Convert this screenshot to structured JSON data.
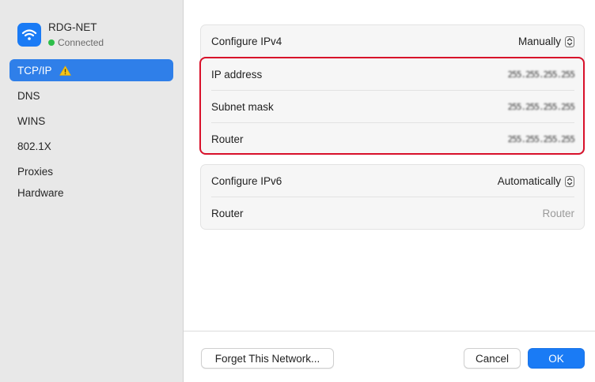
{
  "sidebar": {
    "network": {
      "name": "RDG-NET",
      "status": "Connected"
    },
    "items": [
      {
        "label": "TCP/IP",
        "selected": true,
        "warning": true
      },
      {
        "label": "DNS"
      },
      {
        "label": "WINS"
      },
      {
        "label": "802.1X"
      },
      {
        "label": "Proxies"
      },
      {
        "label": "Hardware"
      }
    ]
  },
  "ipv4": {
    "configure_label": "Configure IPv4",
    "configure_value": "Manually",
    "ip_label": "IP address",
    "ip_value": "255.255.255.255",
    "subnet_label": "Subnet mask",
    "subnet_value": "255.255.255.255",
    "router_label": "Router",
    "router_value": "255.255.255.255"
  },
  "ipv6": {
    "configure_label": "Configure IPv6",
    "configure_value": "Automatically",
    "router_label": "Router",
    "router_placeholder": "Router"
  },
  "footer": {
    "forget_label": "Forget This Network...",
    "cancel_label": "Cancel",
    "ok_label": "OK"
  },
  "colors": {
    "accent": "#1a7bf5",
    "selection": "#2f7fe9",
    "highlight_border": "#d8102a",
    "status_green": "#2dbe4a",
    "warning": "#f5c518"
  }
}
